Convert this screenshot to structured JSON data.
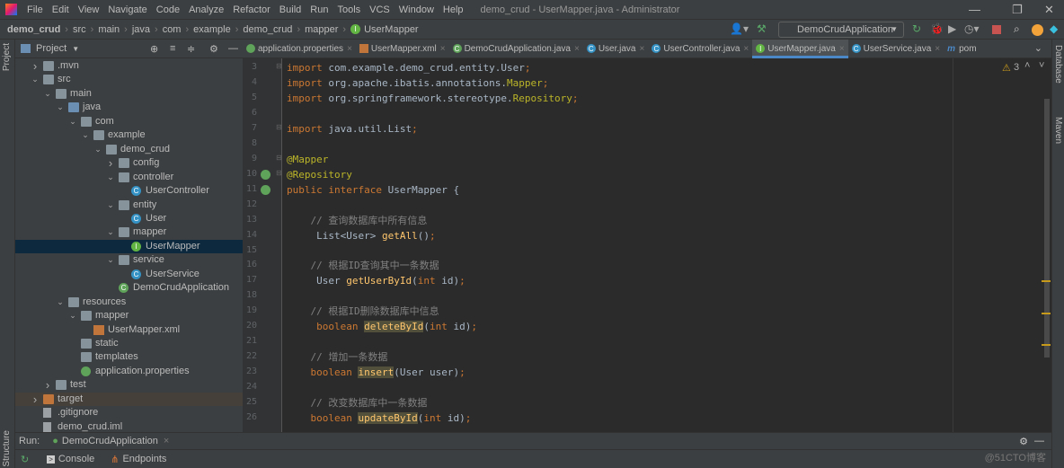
{
  "menu": [
    "File",
    "Edit",
    "View",
    "Navigate",
    "Code",
    "Analyze",
    "Refactor",
    "Build",
    "Run",
    "Tools",
    "VCS",
    "Window",
    "Help"
  ],
  "window_title": "demo_crud - UserMapper.java - Administrator",
  "breadcrumb": [
    "demo_crud",
    "src",
    "main",
    "java",
    "com",
    "example",
    "demo_crud",
    "mapper",
    "UserMapper"
  ],
  "run_config": "DemoCrudApplication",
  "project_panel": {
    "title": "Project",
    "side_label": "Project"
  },
  "tree": [
    {
      "label": ".mvn",
      "level": 1,
      "arrow": "closed",
      "icon": "folder"
    },
    {
      "label": "src",
      "level": 1,
      "arrow": "open",
      "icon": "folder"
    },
    {
      "label": "main",
      "level": 2,
      "arrow": "open",
      "icon": "folder"
    },
    {
      "label": "java",
      "level": 3,
      "arrow": "open",
      "icon": "folder-blue"
    },
    {
      "label": "com",
      "level": 4,
      "arrow": "open",
      "icon": "folder"
    },
    {
      "label": "example",
      "level": 5,
      "arrow": "open",
      "icon": "folder"
    },
    {
      "label": "demo_crud",
      "level": 6,
      "arrow": "open",
      "icon": "folder"
    },
    {
      "label": "config",
      "level": 7,
      "arrow": "closed",
      "icon": "folder"
    },
    {
      "label": "controller",
      "level": 7,
      "arrow": "open",
      "icon": "folder"
    },
    {
      "label": "UserController",
      "level": 8,
      "arrow": "",
      "icon": "class"
    },
    {
      "label": "entity",
      "level": 7,
      "arrow": "open",
      "icon": "folder"
    },
    {
      "label": "User",
      "level": 8,
      "arrow": "",
      "icon": "class"
    },
    {
      "label": "mapper",
      "level": 7,
      "arrow": "open",
      "icon": "folder"
    },
    {
      "label": "UserMapper",
      "level": 8,
      "arrow": "",
      "icon": "interface",
      "selected": true
    },
    {
      "label": "service",
      "level": 7,
      "arrow": "open",
      "icon": "folder"
    },
    {
      "label": "UserService",
      "level": 8,
      "arrow": "",
      "icon": "class"
    },
    {
      "label": "DemoCrudApplication",
      "level": 7,
      "arrow": "",
      "icon": "spring-class"
    },
    {
      "label": "resources",
      "level": 3,
      "arrow": "open",
      "icon": "folder"
    },
    {
      "label": "mapper",
      "level": 4,
      "arrow": "open",
      "icon": "folder"
    },
    {
      "label": "UserMapper.xml",
      "level": 5,
      "arrow": "",
      "icon": "xml"
    },
    {
      "label": "static",
      "level": 4,
      "arrow": "",
      "icon": "folder"
    },
    {
      "label": "templates",
      "level": 4,
      "arrow": "",
      "icon": "folder"
    },
    {
      "label": "application.properties",
      "level": 4,
      "arrow": "",
      "icon": "properties"
    },
    {
      "label": "test",
      "level": 2,
      "arrow": "closed",
      "icon": "folder"
    },
    {
      "label": "target",
      "level": 1,
      "arrow": "closed",
      "icon": "folder-orange",
      "highlight": true
    },
    {
      "label": ".gitignore",
      "level": 1,
      "arrow": "",
      "icon": "file"
    },
    {
      "label": "demo_crud.iml",
      "level": 1,
      "arrow": "",
      "icon": "file"
    }
  ],
  "tabs": [
    {
      "label": "application.properties",
      "icon": "properties"
    },
    {
      "label": "UserMapper.xml",
      "icon": "xml"
    },
    {
      "label": "DemoCrudApplication.java",
      "icon": "spring-class"
    },
    {
      "label": "User.java",
      "icon": "class"
    },
    {
      "label": "UserController.java",
      "icon": "class"
    },
    {
      "label": "UserMapper.java",
      "icon": "interface",
      "active": true
    },
    {
      "label": "UserService.java",
      "icon": "class"
    },
    {
      "label": "pom",
      "icon": "maven"
    }
  ],
  "editor": {
    "warning_count": "3",
    "lines": [
      {
        "n": "3",
        "t": [
          [
            "kw",
            "import "
          ],
          [
            "pl",
            "com.example.demo_crud.entity.User"
          ],
          [
            "kw",
            ";"
          ]
        ]
      },
      {
        "n": "4",
        "t": [
          [
            "kw",
            "import "
          ],
          [
            "pl",
            "org.apache.ibatis.annotations."
          ],
          [
            "an",
            "Mapper"
          ],
          [
            "kw",
            ";"
          ]
        ]
      },
      {
        "n": "5",
        "t": [
          [
            "kw",
            "import "
          ],
          [
            "pl",
            "org.springframework.stereotype."
          ],
          [
            "an",
            "Repository"
          ],
          [
            "kw",
            ";"
          ]
        ]
      },
      {
        "n": "6",
        "t": []
      },
      {
        "n": "7",
        "t": [
          [
            "kw",
            "import "
          ],
          [
            "pl",
            "java.util.List"
          ],
          [
            "kw",
            ";"
          ]
        ]
      },
      {
        "n": "8",
        "t": []
      },
      {
        "n": "9",
        "t": [
          [
            "an",
            "@Mapper"
          ]
        ]
      },
      {
        "n": "10",
        "t": [
          [
            "an",
            "@Repository"
          ]
        ]
      },
      {
        "n": "11",
        "t": [
          [
            "kw",
            "public interface "
          ],
          [
            "pl",
            "UserMapper {"
          ]
        ]
      },
      {
        "n": "12",
        "t": []
      },
      {
        "n": "13",
        "t": [
          [
            "cm",
            "    // 查询数据库中所有信息"
          ]
        ]
      },
      {
        "n": "14",
        "t": [
          [
            "pl",
            "     List<User> "
          ],
          [
            "fn",
            "getAll"
          ],
          [
            "pl",
            "()"
          ],
          [
            "kw",
            ";"
          ]
        ]
      },
      {
        "n": "15",
        "t": []
      },
      {
        "n": "16",
        "t": [
          [
            "cm",
            "    // 根据ID查询其中一条数据"
          ]
        ]
      },
      {
        "n": "17",
        "t": [
          [
            "pl",
            "     User "
          ],
          [
            "fn",
            "getUserById"
          ],
          [
            "pl",
            "("
          ],
          [
            "kw",
            "int "
          ],
          [
            "pl",
            "id)"
          ],
          [
            "kw",
            ";"
          ]
        ]
      },
      {
        "n": "18",
        "t": []
      },
      {
        "n": "19",
        "t": [
          [
            "cm",
            "    // 根据ID删除数据库中信息"
          ]
        ]
      },
      {
        "n": "20",
        "t": [
          [
            "kw",
            "     boolean "
          ],
          [
            "hl",
            "deleteById"
          ],
          [
            "pl",
            "("
          ],
          [
            "kw",
            "int "
          ],
          [
            "pl",
            "id)"
          ],
          [
            "kw",
            ";"
          ]
        ]
      },
      {
        "n": "21",
        "t": []
      },
      {
        "n": "22",
        "t": [
          [
            "cm",
            "    // 增加一条数据"
          ]
        ]
      },
      {
        "n": "23",
        "t": [
          [
            "kw",
            "    boolean "
          ],
          [
            "hl",
            "insert"
          ],
          [
            "pl",
            "(User user)"
          ],
          [
            "kw",
            ";"
          ]
        ]
      },
      {
        "n": "24",
        "t": []
      },
      {
        "n": "25",
        "t": [
          [
            "cm",
            "    // 改变数据库中一条数据"
          ]
        ]
      },
      {
        "n": "26",
        "t": [
          [
            "kw",
            "    boolean "
          ],
          [
            "hl",
            "updateById"
          ],
          [
            "pl",
            "("
          ],
          [
            "kw",
            "int "
          ],
          [
            "pl",
            "id)"
          ],
          [
            "kw",
            ";"
          ]
        ]
      }
    ]
  },
  "run": {
    "label": "Run:",
    "config": "DemoCrudApplication"
  },
  "bottom": {
    "console": "Console",
    "endpoints": "Endpoints",
    "structure": "Structure"
  },
  "right_strip": {
    "database": "Database",
    "maven": "Maven"
  },
  "watermark": "@51CTO博客",
  "colors": {
    "accent": "#4a88c7",
    "selection": "#0d293e",
    "warning": "#c89a1c"
  }
}
